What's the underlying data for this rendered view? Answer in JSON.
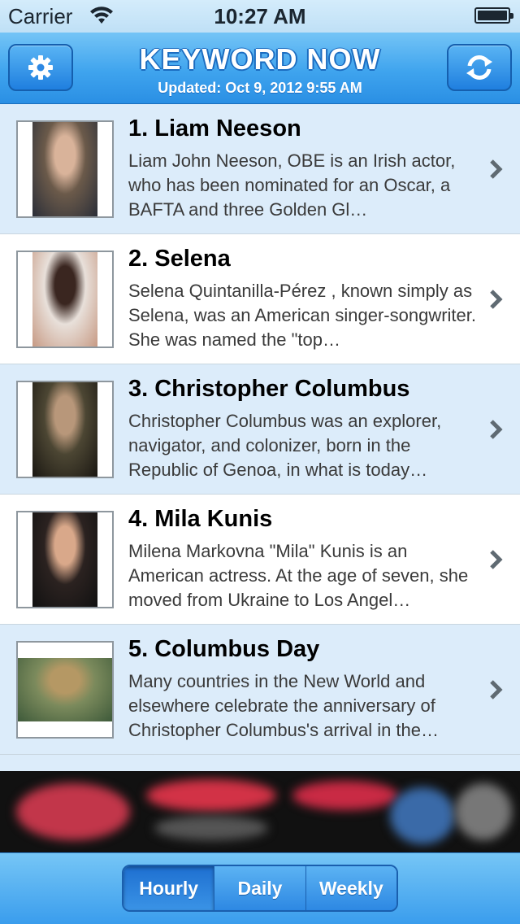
{
  "status_bar": {
    "carrier": "Carrier",
    "time": "10:27 AM",
    "wifi_icon": "wifi-icon",
    "battery_icon": "battery-icon"
  },
  "nav": {
    "title": "KEYWORD NOW",
    "subtitle": "Updated: Oct 9, 2012 9:55 AM",
    "left_icon": "gear-icon",
    "right_icon": "refresh-icon"
  },
  "items": [
    {
      "title": "1. Liam Neeson",
      "description": "Liam John Neeson, OBE is an Irish actor, who has been nominated for an Oscar, a BAFTA and three Golden Gl…",
      "thumb_colors": [
        "#6b5a4a",
        "#d9b39a",
        "#2a2e38"
      ]
    },
    {
      "title": "2. Selena",
      "description": "Selena Quintanilla-Pérez , known simply as Selena, was an American singer-songwriter. She was named the \"top…",
      "thumb_colors": [
        "#e8e0da",
        "#3a2620",
        "#c79a84"
      ]
    },
    {
      "title": "3. Christopher Columbus",
      "description": "Christopher Columbus was an explorer, navigator, and colonizer, born in the Republic of Genoa, in what is today…",
      "thumb_colors": [
        "#4c4633",
        "#b8977a",
        "#1a1712"
      ]
    },
    {
      "title": "4. Mila Kunis",
      "description": "Milena Markovna \"Mila\" Kunis is an American actress. At the age of seven, she moved from Ukraine to Los Angel…",
      "thumb_colors": [
        "#2b2220",
        "#d9a88a",
        "#111111"
      ]
    },
    {
      "title": "5. Columbus Day",
      "description": "Many countries in the New World and elsewhere celebrate the anniversary of Christopher Columbus's arrival in the…",
      "thumb_colors": [
        "#7b8a5c",
        "#b59864",
        "#3e5a3a"
      ]
    }
  ],
  "tabs": [
    {
      "label": "Hourly",
      "active": true
    },
    {
      "label": "Daily",
      "active": false
    },
    {
      "label": "Weekly",
      "active": false
    }
  ],
  "colors": {
    "nav_blue": "#3fa4ee",
    "row_shaded": "#dcecfa",
    "row_plain": "#ffffff"
  }
}
